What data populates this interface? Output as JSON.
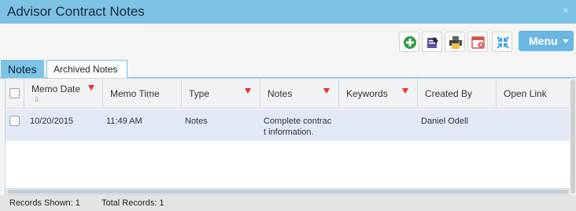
{
  "window": {
    "title": "Advisor Contract Notes",
    "close_label": "×"
  },
  "toolbar": {
    "buttons": [
      {
        "name": "add-icon",
        "color": "#2e9b3f"
      },
      {
        "name": "edit-note-icon",
        "color": "#5a4fa0"
      },
      {
        "name": "print-icon",
        "color": "#444444"
      },
      {
        "name": "calendar-icon",
        "color": "#d9534f"
      },
      {
        "name": "collapse-icon",
        "color": "#3aa6e0"
      }
    ],
    "menu_label": "Menu"
  },
  "tabs": [
    {
      "label": "Notes",
      "active": true
    },
    {
      "label": "Archived Notes",
      "active": false
    }
  ],
  "grid": {
    "columns": [
      {
        "label": "Memo Date",
        "filter": true,
        "sorted": true
      },
      {
        "label": "Memo Time",
        "filter": false
      },
      {
        "label": "Type",
        "filter": true
      },
      {
        "label": "Notes",
        "filter": true
      },
      {
        "label": "Keywords",
        "filter": true
      },
      {
        "label": "Created By",
        "filter": false
      },
      {
        "label": "Open Link",
        "filter": false
      }
    ],
    "rows": [
      {
        "memo_date": "10/20/2015",
        "memo_time": "11:49 AM",
        "type": "Notes",
        "notes_line1": "Complete contrac",
        "notes_line2": "t information.",
        "keywords": "",
        "created_by": "Daniel Odell",
        "open_link": ""
      }
    ]
  },
  "footer": {
    "records_shown": "Records Shown: 1",
    "total_records": "Total Records: 1"
  },
  "colors": {
    "titlebar": "#7cc3e6",
    "menu_button": "#69b7e2",
    "selected_row": "#e3e8f5",
    "filter_icon": "#e63232"
  }
}
